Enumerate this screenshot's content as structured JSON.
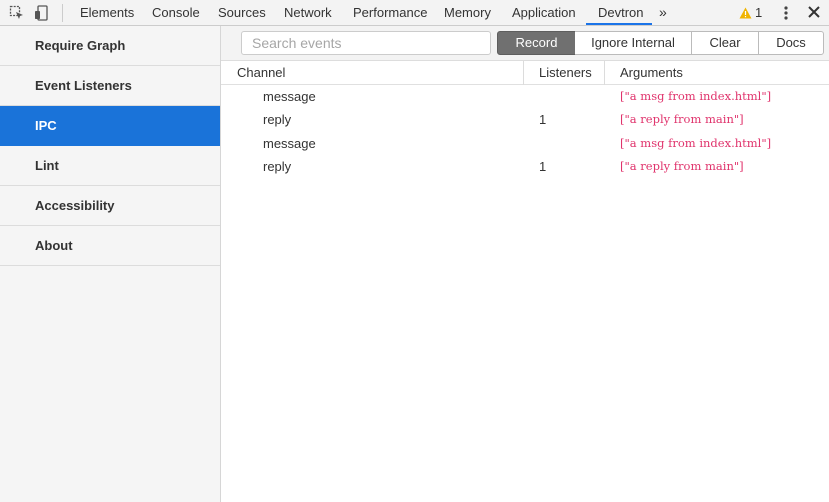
{
  "devtools": {
    "tabs": [
      {
        "label": "Elements"
      },
      {
        "label": "Console"
      },
      {
        "label": "Sources"
      },
      {
        "label": "Network"
      },
      {
        "label": "Performance"
      },
      {
        "label": "Memory"
      },
      {
        "label": "Application"
      },
      {
        "label": "Devtron"
      }
    ],
    "active_tab": "Devtron",
    "overflow_glyph": "»",
    "warning_count": "1",
    "icons": [
      "inspect-element-icon",
      "device-toolbar-icon",
      "chevron-overflow-icon",
      "warning-icon",
      "kebab-menu-icon",
      "close-icon"
    ]
  },
  "sidebar": {
    "items": [
      {
        "label": "Require Graph"
      },
      {
        "label": "Event Listeners"
      },
      {
        "label": "IPC"
      },
      {
        "label": "Lint"
      },
      {
        "label": "Accessibility"
      },
      {
        "label": "About"
      }
    ],
    "active": "IPC"
  },
  "toolbar": {
    "search_placeholder": "Search events",
    "record_label": "Record",
    "ignore_label": "Ignore Internal",
    "clear_label": "Clear",
    "docs_label": "Docs"
  },
  "table": {
    "columns": [
      "Channel",
      "Listeners",
      "Arguments"
    ],
    "rows": [
      {
        "channel": "message",
        "listeners": "",
        "arguments": "[\"a msg from index.html\"]"
      },
      {
        "channel": "reply",
        "listeners": "1",
        "arguments": "[\"a reply from main\"]"
      },
      {
        "channel": "message",
        "listeners": "",
        "arguments": "[\"a msg from index.html\"]"
      },
      {
        "channel": "reply",
        "listeners": "1",
        "arguments": "[\"a reply from main\"]"
      }
    ]
  },
  "colors": {
    "accent": "#1a73d9",
    "arguments_text": "#e0336c",
    "record_active": "#707070",
    "warning": "#f0b400"
  }
}
